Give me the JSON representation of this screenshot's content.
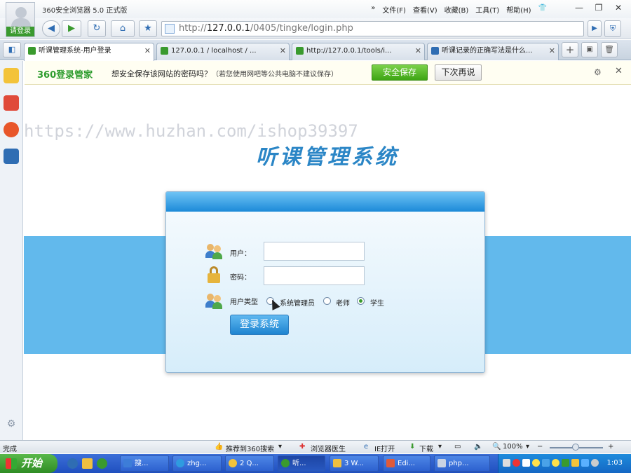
{
  "browser": {
    "app_title": "360安全浏览器 5.0 正式版",
    "login_button": "请登录",
    "menu": [
      "文件(F)",
      "查看(V)",
      "收藏(B)",
      "工具(T)",
      "帮助(H)"
    ],
    "menu_arrow": "»",
    "window_controls": {
      "minimize": "—",
      "restore": "❐",
      "close": "✕"
    }
  },
  "navbar": {
    "back": "◀",
    "forward": "▶",
    "refresh": "↻",
    "home": "⌂",
    "favorite": "★",
    "address_prefix": "http://",
    "address_host": "127.0.0.1",
    "address_path": "/0405/tingke/login.php"
  },
  "tabs": [
    {
      "label": "听课管理系统-用户登录",
      "active": true
    },
    {
      "label": "127.0.0.1 / localhost / ...",
      "active": false
    },
    {
      "label": "http://127.0.0.1/tools/i...",
      "active": false
    },
    {
      "label": "听课记录的正确写法是什么...",
      "active": false
    }
  ],
  "tab_close": "✕",
  "tab_new": "+",
  "password_bar": {
    "logo": "360登录管家",
    "message": "想安全保存该网站的密码吗？",
    "note": "（若您使用网吧等公共电脑不建议保存）",
    "save_button": "安全保存",
    "later_button": "下次再说",
    "gear": "⚙",
    "close": "✕"
  },
  "watermark": "https://www.huzhan.com/ishop39397",
  "page": {
    "system_title": "听课管理系统",
    "username_label": "用户：",
    "password_label": "密码：",
    "usertype_label": "用户类型",
    "roles": [
      {
        "label": "系统管理员",
        "selected": false
      },
      {
        "label": "老师",
        "selected": false
      },
      {
        "label": "学生",
        "selected": true
      }
    ],
    "submit_button": "登录系统",
    "username_value": "",
    "password_value": ""
  },
  "statusbar": {
    "status": "完成",
    "search": "推荐到360搜索",
    "doctor": "浏览器医生",
    "ie_open": "IE打开",
    "download": "下载",
    "zoom": "100%",
    "zoom_minus": "−",
    "zoom_plus": "+"
  },
  "taskbar": {
    "start": "开始",
    "tasks": [
      "搜...",
      "zhg...",
      "2 Q...",
      "听...",
      "3 W...",
      "Edi...",
      "php..."
    ],
    "clock": "1:03"
  },
  "colors": {
    "accent": "#2b86c6",
    "band": "#62b9ec",
    "green": "#3a9a2e"
  }
}
